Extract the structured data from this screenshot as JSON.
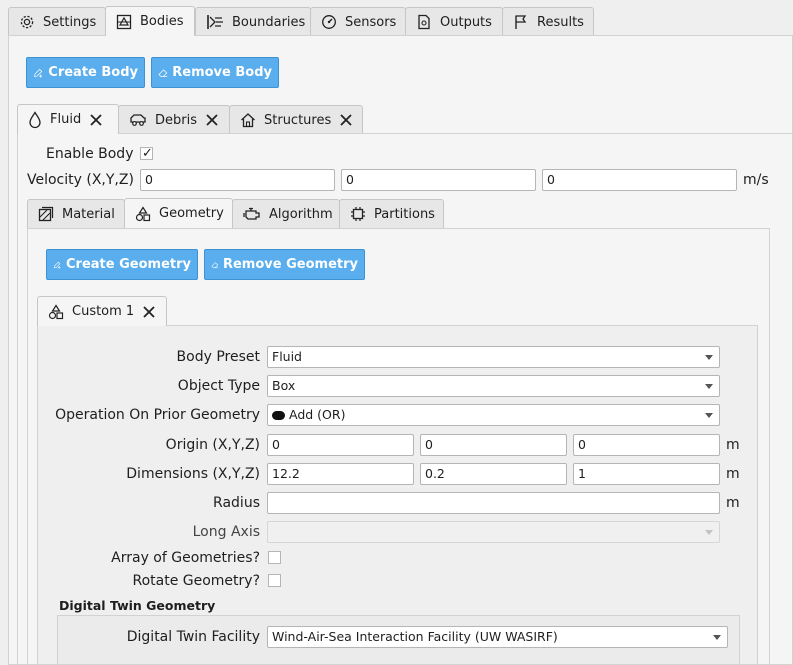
{
  "top_tabs": [
    {
      "label": "Settings",
      "icon": "gear-icon"
    },
    {
      "label": "Bodies",
      "icon": "bodies-icon"
    },
    {
      "label": "Boundaries",
      "icon": "boundaries-icon"
    },
    {
      "label": "Sensors",
      "icon": "sensor-icon"
    },
    {
      "label": "Outputs",
      "icon": "outputs-icon"
    },
    {
      "label": "Results",
      "icon": "flag-icon"
    }
  ],
  "body_actions": {
    "create": "Create Body",
    "remove": "Remove Body"
  },
  "body_tabs": [
    {
      "label": "Fluid",
      "icon": "droplet-icon"
    },
    {
      "label": "Debris",
      "icon": "vehicle-icon"
    },
    {
      "label": "Structures",
      "icon": "house-icon"
    }
  ],
  "enable_body": {
    "label": "Enable Body",
    "checked": true,
    "mark": "✓"
  },
  "velocity": {
    "label": "Velocity (X,Y,Z)",
    "x": "0",
    "y": "0",
    "z": "0",
    "unit": "m/s"
  },
  "sub_tabs": [
    {
      "label": "Material",
      "icon": "material-icon"
    },
    {
      "label": "Geometry",
      "icon": "shapes-icon"
    },
    {
      "label": "Algorithm",
      "icon": "engine-icon"
    },
    {
      "label": "Partitions",
      "icon": "chip-icon"
    }
  ],
  "geometry_actions": {
    "create": "Create Geometry",
    "remove": "Remove Geometry"
  },
  "geometry_tab": {
    "label": "Custom 1",
    "icon": "shapes-icon"
  },
  "form": {
    "body_preset": {
      "label": "Body Preset",
      "value": "Fluid"
    },
    "object_type": {
      "label": "Object Type",
      "value": "Box"
    },
    "operation": {
      "label": "Operation On Prior Geometry",
      "value": "Add (OR)"
    },
    "origin": {
      "label": "Origin (X,Y,Z)",
      "x": "0",
      "y": "0",
      "z": "0",
      "unit": "m"
    },
    "dimensions": {
      "label": "Dimensions (X,Y,Z)",
      "x": "12.2",
      "y": "0.2",
      "z": "1",
      "unit": "m"
    },
    "radius": {
      "label": "Radius",
      "value": "",
      "unit": "m"
    },
    "long_axis": {
      "label": "Long Axis",
      "value": ""
    },
    "array": {
      "label": "Array of Geometries?",
      "checked": false
    },
    "rotate": {
      "label": "Rotate Geometry?",
      "checked": false
    }
  },
  "digital_twin": {
    "heading": "Digital Twin Geometry",
    "facility_label": "Digital Twin Facility",
    "facility_value": "Wind-Air-Sea Interaction Facility (UW WASIRF)"
  },
  "colors": {
    "accent": "#5aaeee",
    "accent_border": "#3b93d6"
  }
}
